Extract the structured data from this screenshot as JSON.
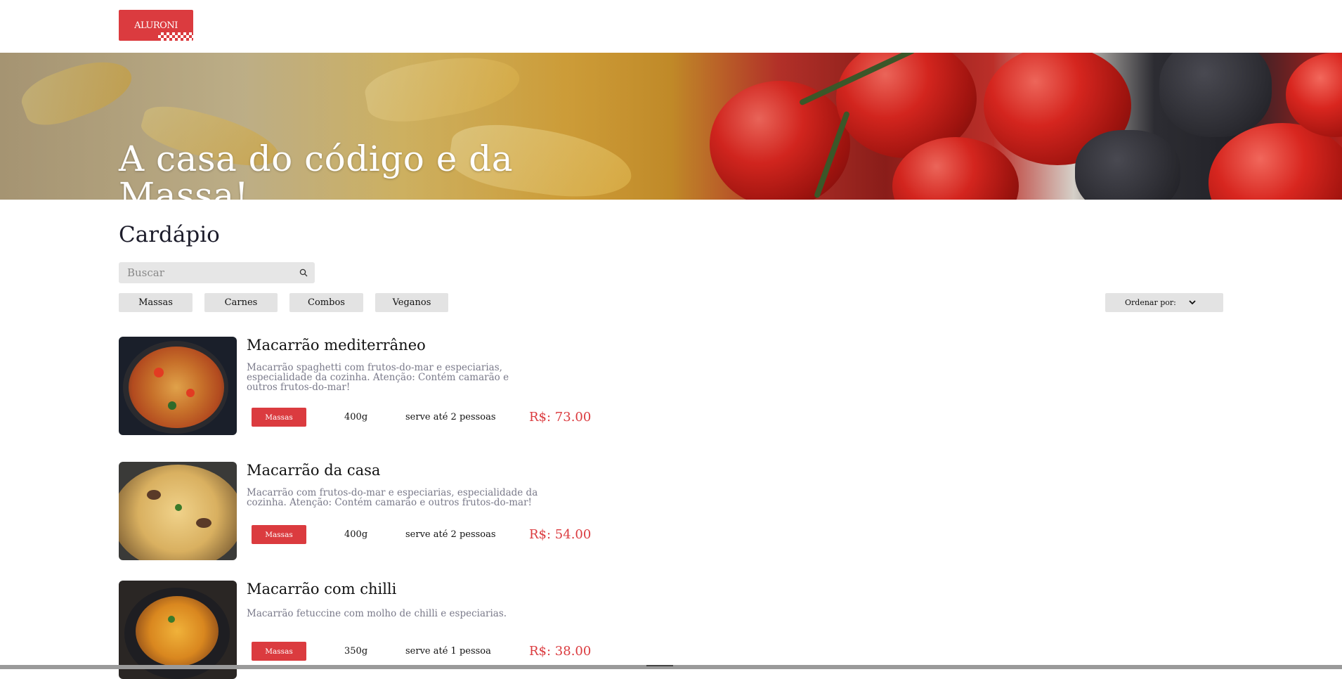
{
  "header": {
    "logo_text": "ALURONI"
  },
  "banner": {
    "title": "A casa do código e da Massa!"
  },
  "menu": {
    "title": "Cardápio",
    "search": {
      "placeholder": "Buscar"
    },
    "filters": [
      "Massas",
      "Carnes",
      "Combos",
      "Veganos"
    ],
    "order_by": {
      "label": "Ordenar por:"
    },
    "items": [
      {
        "name": "Macarrão mediterrâneo",
        "description": "Macarrão spaghetti com frutos-do-mar e especiarias, especialidade da cozinha. Atenção: Contém camarão e outros frutos-do-mar!",
        "category": "Massas",
        "weight": "400g",
        "serves": "serve até 2 pessoas",
        "price": "R$: 73.00"
      },
      {
        "name": "Macarrão da casa",
        "description": "Macarrão com frutos-do-mar e especiarias, especialidade da cozinha. Atenção: Contém camarão e outros frutos-do-mar!",
        "category": "Massas",
        "weight": "400g",
        "serves": "serve até 2 pessoas",
        "price": "R$: 54.00"
      },
      {
        "name": "Macarrão com chilli",
        "description": "Macarrão fetuccine com molho de chilli e especiarias.",
        "category": "Massas",
        "weight": "350g",
        "serves": "serve até 1 pessoa",
        "price": "R$: 38.00"
      }
    ]
  },
  "colors": {
    "brand_red": "#db3b3f",
    "chip_gray": "#e3e3e3",
    "description_gray": "#7a7a8a"
  },
  "icons": {
    "search": "search-icon",
    "order_toggle": "chevron-down-icon"
  }
}
